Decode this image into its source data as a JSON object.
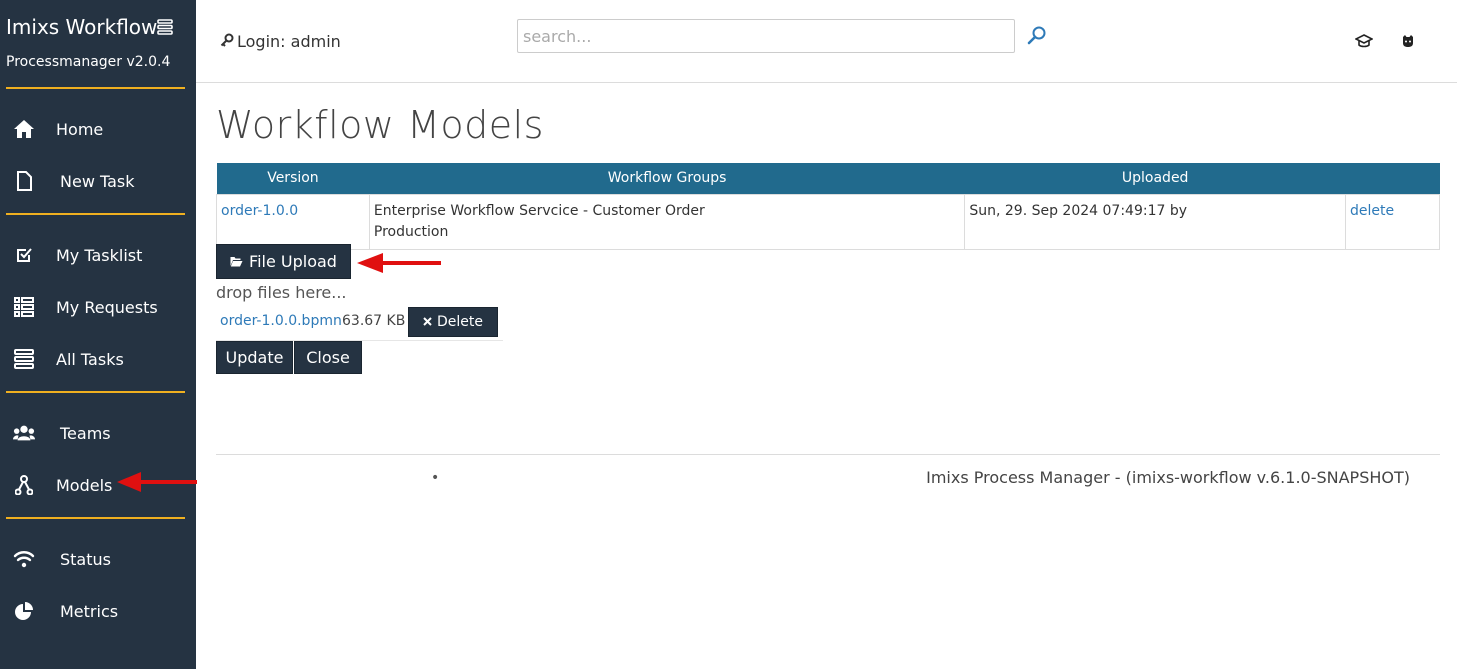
{
  "sidebar": {
    "brand": "Imixs Workflow",
    "version": "Processmanager v2.0.4",
    "items": [
      {
        "label": "Home",
        "icon": "home-icon"
      },
      {
        "label": "New Task",
        "icon": "file-icon"
      },
      {
        "label": "My Tasklist",
        "icon": "check-square-icon"
      },
      {
        "label": "My Requests",
        "icon": "list-icon"
      },
      {
        "label": "All Tasks",
        "icon": "stack-icon"
      },
      {
        "label": "Teams",
        "icon": "users-icon"
      },
      {
        "label": "Models",
        "icon": "fork-icon"
      },
      {
        "label": "Status",
        "icon": "wifi-icon"
      },
      {
        "label": "Metrics",
        "icon": "pie-chart-icon"
      }
    ]
  },
  "header": {
    "login": "Login: admin",
    "search_placeholder": "search..."
  },
  "main": {
    "title": "Workflow Models",
    "table": {
      "headers": [
        "Version",
        "Workflow Groups",
        "Uploaded",
        ""
      ],
      "rows": [
        {
          "version": "order-1.0.0",
          "groups_line1": "Enterprise Workflow Servcice - Customer Order",
          "groups_line2": "Production",
          "uploaded": "Sun, 29. Sep 2024 07:49:17 by",
          "action": "delete"
        }
      ]
    },
    "upload_label": "File Upload",
    "drop_text": "drop files here...",
    "file": {
      "name": "order-1.0.0.bpmn",
      "size": "63.67 KB",
      "delete_label": "Delete"
    },
    "update_label": "Update",
    "close_label": "Close"
  },
  "footer": {
    "text": "Imixs Process Manager - (imixs-workflow v.6.1.0-SNAPSHOT)"
  },
  "colors": {
    "sidebar_bg": "#253342",
    "accent": "#f0b020",
    "table_header": "#216a8d",
    "link": "#2e7ab8",
    "annotation_arrow": "#e01010"
  }
}
